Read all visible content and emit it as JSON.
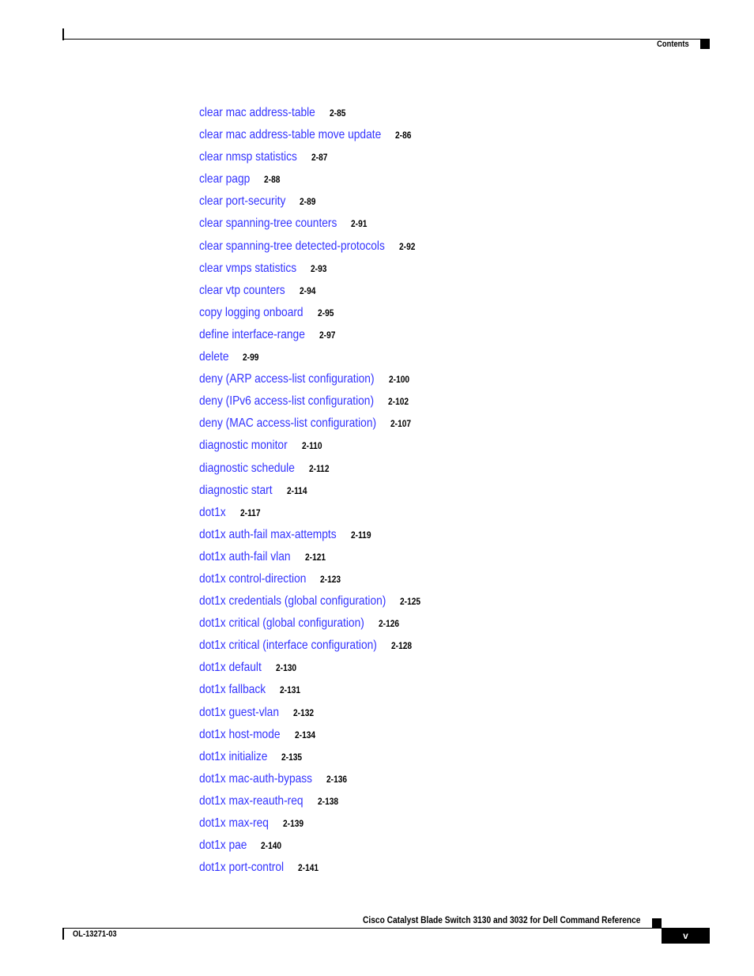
{
  "header": {
    "section": "Contents"
  },
  "toc": [
    {
      "title": "clear mac address-table",
      "page": "2-85"
    },
    {
      "title": "clear mac address-table move update",
      "page": "2-86"
    },
    {
      "title": "clear nmsp statistics",
      "page": "2-87"
    },
    {
      "title": "clear pagp",
      "page": "2-88"
    },
    {
      "title": "clear port-security",
      "page": "2-89"
    },
    {
      "title": "clear spanning-tree counters",
      "page": "2-91"
    },
    {
      "title": "clear spanning-tree detected-protocols",
      "page": "2-92"
    },
    {
      "title": "clear vmps statistics",
      "page": "2-93"
    },
    {
      "title": "clear vtp counters",
      "page": "2-94"
    },
    {
      "title": "copy logging onboard",
      "page": "2-95"
    },
    {
      "title": "define interface-range",
      "page": "2-97"
    },
    {
      "title": "delete",
      "page": "2-99"
    },
    {
      "title": "deny (ARP access-list configuration)",
      "page": "2-100"
    },
    {
      "title": "deny (IPv6 access-list configuration)",
      "page": "2-102"
    },
    {
      "title": "deny (MAC access-list configuration)",
      "page": "2-107"
    },
    {
      "title": "diagnostic monitor",
      "page": "2-110"
    },
    {
      "title": "diagnostic schedule",
      "page": "2-112"
    },
    {
      "title": "diagnostic start",
      "page": "2-114"
    },
    {
      "title": "dot1x",
      "page": "2-117"
    },
    {
      "title": "dot1x auth-fail max-attempts",
      "page": "2-119"
    },
    {
      "title": "dot1x auth-fail vlan",
      "page": "2-121"
    },
    {
      "title": "dot1x control-direction",
      "page": "2-123"
    },
    {
      "title": "dot1x credentials (global configuration)",
      "page": "2-125"
    },
    {
      "title": "dot1x critical (global configuration)",
      "page": "2-126"
    },
    {
      "title": "dot1x critical (interface configuration)",
      "page": "2-128"
    },
    {
      "title": "dot1x default",
      "page": "2-130"
    },
    {
      "title": "dot1x fallback",
      "page": "2-131"
    },
    {
      "title": "dot1x guest-vlan",
      "page": "2-132"
    },
    {
      "title": "dot1x host-mode",
      "page": "2-134"
    },
    {
      "title": "dot1x initialize",
      "page": "2-135"
    },
    {
      "title": "dot1x mac-auth-bypass",
      "page": "2-136"
    },
    {
      "title": "dot1x max-reauth-req",
      "page": "2-138"
    },
    {
      "title": "dot1x max-req",
      "page": "2-139"
    },
    {
      "title": "dot1x pae",
      "page": "2-140"
    },
    {
      "title": "dot1x port-control",
      "page": "2-141"
    }
  ],
  "footer": {
    "book_title": "Cisco Catalyst Blade Switch 3130 and 3032 for Dell Command Reference",
    "doc_number": "OL-13271-03",
    "page_number": "v"
  }
}
